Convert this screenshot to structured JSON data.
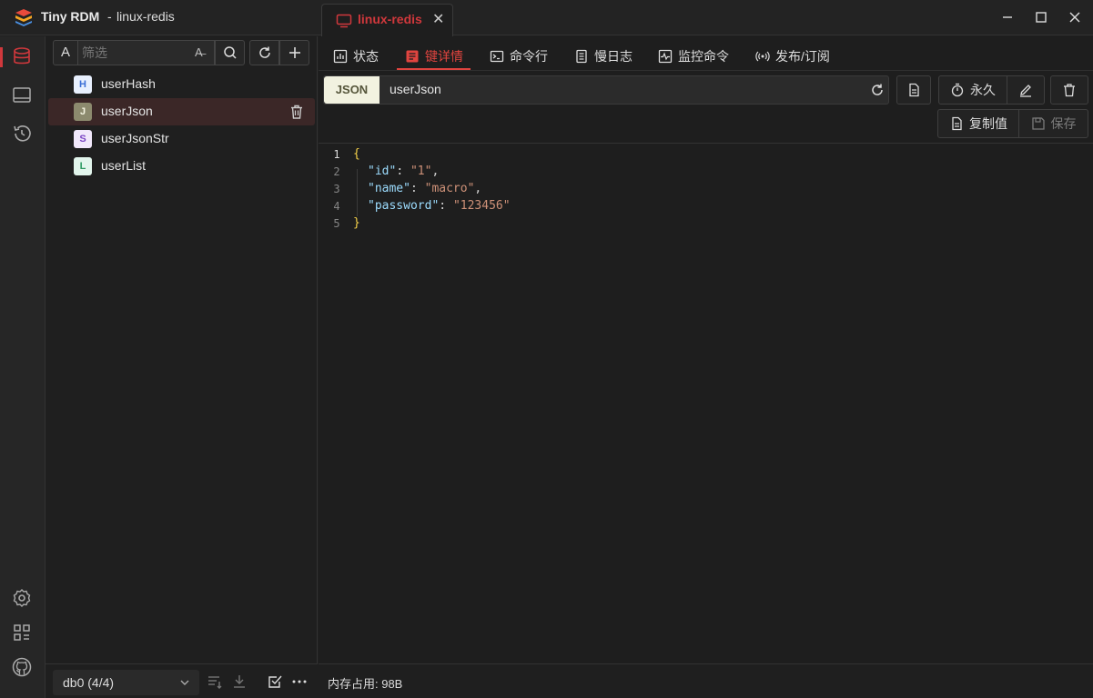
{
  "titlebar": {
    "app_name": "Tiny RDM",
    "separator": "-",
    "connection": "linux-redis",
    "tab_label": "linux-redis",
    "tab_close": "✕"
  },
  "sidebar": {
    "icons": [
      "database-icon",
      "terminal-window-icon",
      "history-icon",
      "settings-icon",
      "apps-icon",
      "github-icon"
    ]
  },
  "keypanel": {
    "filter_type": "A",
    "filter_placeholder": "筛选",
    "filter_match_icon": "A̶",
    "keys": [
      {
        "type": "H",
        "name": "userHash",
        "badge_bg": "#e8f0fe",
        "badge_fg": "#3b6fd6"
      },
      {
        "type": "J",
        "name": "userJson",
        "badge_bg": "#8c8a6e",
        "badge_fg": "#f4f4e0"
      },
      {
        "type": "S",
        "name": "userJsonStr",
        "badge_bg": "#f1e8fb",
        "badge_fg": "#7a45c4"
      },
      {
        "type": "L",
        "name": "userList",
        "badge_bg": "#e2f5ec",
        "badge_fg": "#2e9a63"
      }
    ],
    "db_select": "db0 (4/4)"
  },
  "tabs": [
    {
      "label": "状态",
      "icon": "status-icon"
    },
    {
      "label": "键详情",
      "icon": "key-detail-icon",
      "active": true
    },
    {
      "label": "命令行",
      "icon": "terminal-icon"
    },
    {
      "label": "慢日志",
      "icon": "slowlog-icon"
    },
    {
      "label": "监控命令",
      "icon": "monitor-icon"
    },
    {
      "label": "发布/订阅",
      "icon": "pubsub-icon"
    }
  ],
  "keydetail": {
    "type_badge": "JSON",
    "key_name": "userJson",
    "ttl_label": "永久",
    "copy_label": "复制值",
    "save_label": "保存"
  },
  "editor": {
    "lines": [
      "1",
      "2",
      "3",
      "4",
      "5"
    ],
    "open_brace": "{",
    "close_brace": "}",
    "fields": [
      {
        "key": "\"id\"",
        "value": "\"1\"",
        "comma": ","
      },
      {
        "key": "\"name\"",
        "value": "\"macro\"",
        "comma": ","
      },
      {
        "key": "\"password\"",
        "value": "\"123456\"",
        "comma": ""
      }
    ]
  },
  "status": {
    "memory": "内存占用: 98B"
  },
  "colors": {
    "accent": "#e0443f",
    "background": "#1e1e1e",
    "selected_row": "#3b2727"
  }
}
